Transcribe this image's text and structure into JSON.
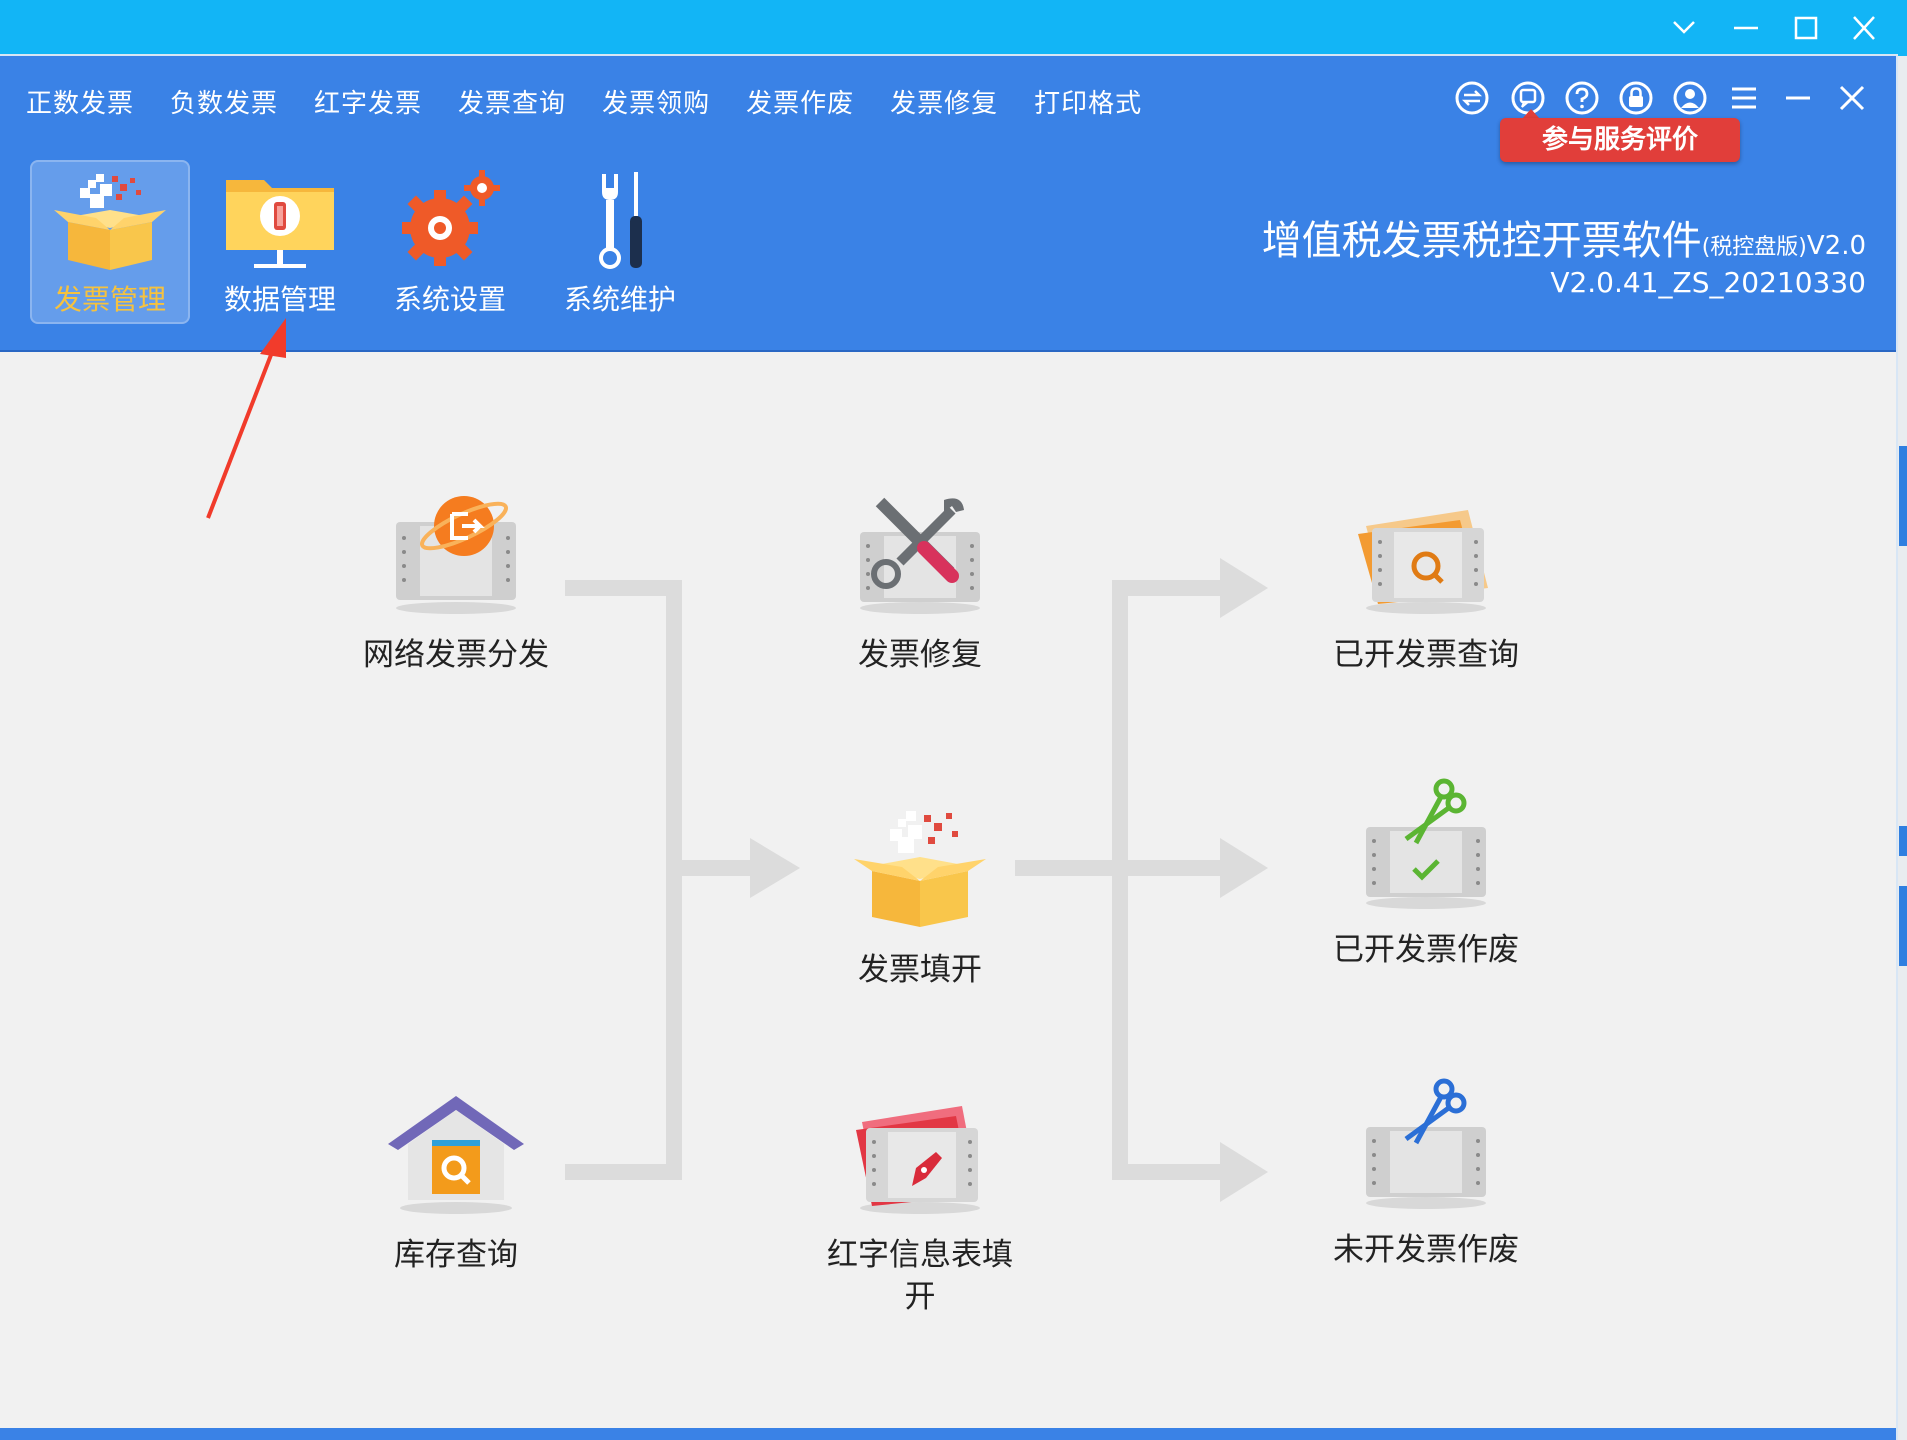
{
  "menu": [
    "正数发票",
    "负数发票",
    "红字发票",
    "发票查询",
    "发票领购",
    "发票作废",
    "发票修复",
    "打印格式"
  ],
  "header_icons": [
    "switch-icon",
    "service-icon",
    "help-icon",
    "lock-icon",
    "user-icon",
    "menu-icon",
    "minimize-icon",
    "close-icon"
  ],
  "service_tip": "参与服务评价",
  "tools": [
    {
      "label": "发票管理",
      "icon": "invoice-box-icon",
      "active": true
    },
    {
      "label": "数据管理",
      "icon": "data-folder-icon",
      "active": false
    },
    {
      "label": "系统设置",
      "icon": "gear-icon",
      "active": false
    },
    {
      "label": "系统维护",
      "icon": "tools-icon",
      "active": false
    }
  ],
  "app": {
    "title": "增值税发票税控开票软件",
    "edition": "(税控盘版)",
    "version_suffix": "V2.0",
    "build": "V2.0.41_ZS_20210330"
  },
  "flow": {
    "left": [
      {
        "label": "网络发票分发",
        "icon": "network-distribute-icon"
      },
      {
        "label": "库存查询",
        "icon": "inventory-house-icon"
      }
    ],
    "center": [
      {
        "label": "发票修复",
        "icon": "repair-icon"
      },
      {
        "label": "发票填开",
        "icon": "fill-invoice-icon"
      },
      {
        "label": "红字信息表填开",
        "icon": "red-info-icon"
      }
    ],
    "right": [
      {
        "label": "已开发票查询",
        "icon": "issued-query-icon"
      },
      {
        "label": "已开发票作废",
        "icon": "issued-void-icon"
      },
      {
        "label": "未开发票作废",
        "icon": "unissued-void-icon"
      }
    ]
  },
  "colors": {
    "header": "#3a82e6",
    "titlebar": "#12b5f6",
    "accent_active": "#f6c23e",
    "eval_red": "#e13e3a",
    "arrow_gray": "#d9d9d9"
  }
}
